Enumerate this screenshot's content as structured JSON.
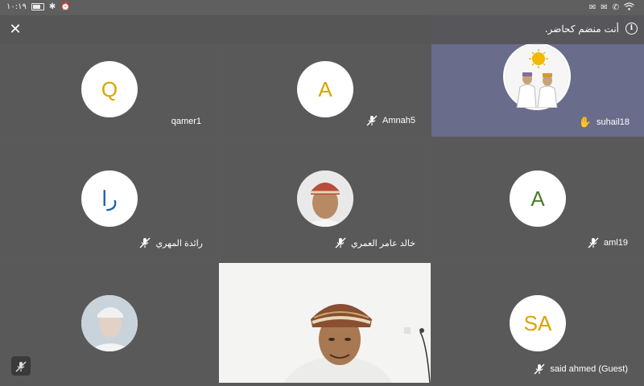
{
  "status": {
    "time": "١٠:١٩"
  },
  "banner": {
    "text": "أنت منضم كحاضر."
  },
  "participants": [
    {
      "name": "qamer1",
      "initial": "Q",
      "color": "#d9a400"
    },
    {
      "name": "Amnah5",
      "initial": "A",
      "color": "#d9a400"
    },
    {
      "name": "suhail18",
      "initial": "",
      "color": "#c8a000"
    },
    {
      "name": "رائدة المهري",
      "initial": "را",
      "color": "#1d5fa8"
    },
    {
      "name": "خالد عامر العمري",
      "initial": "",
      "color": ""
    },
    {
      "name": "aml19",
      "initial": "A",
      "color": "#4e7a2e"
    },
    {
      "name": "",
      "initial": "",
      "color": ""
    },
    {
      "name": "",
      "initial": "",
      "color": ""
    },
    {
      "name": "said ahmed (Guest)",
      "initial": "SA",
      "color": "#d9a400"
    }
  ]
}
